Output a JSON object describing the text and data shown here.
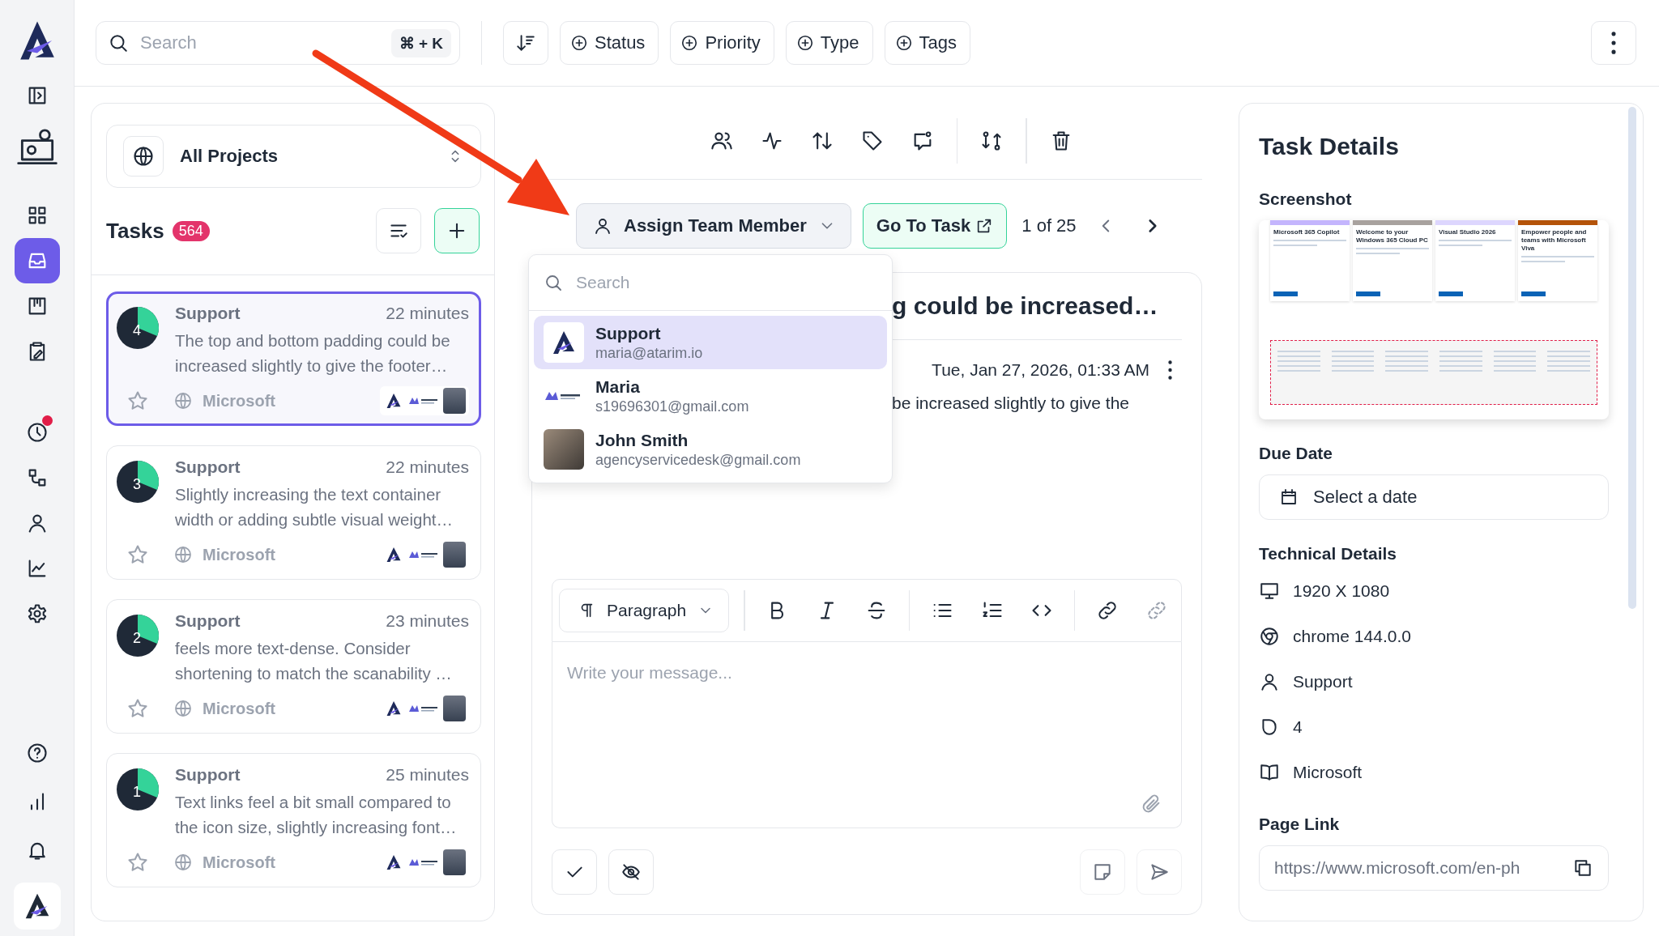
{
  "sidebar": {
    "items": [
      {
        "selected": false
      },
      {
        "selected": false
      },
      {
        "selected": false
      },
      {
        "selected": true
      },
      {
        "selected": false
      },
      {
        "selected": false
      },
      {
        "selected": false,
        "alert": true
      },
      {
        "selected": false
      },
      {
        "selected": false
      },
      {
        "selected": false
      },
      {
        "selected": false
      }
    ],
    "bottom_items": [
      {
        "selected": false
      },
      {
        "selected": false
      },
      {
        "selected": false
      }
    ]
  },
  "top_bar": {
    "search": {
      "placeholder": "Search",
      "shortcut": "⌘ + K"
    },
    "filters": [
      "Status",
      "Priority",
      "Type",
      "Tags"
    ]
  },
  "task_list": {
    "project": "All Projects",
    "title": "Tasks",
    "count": "564",
    "tasks": [
      {
        "number": "4",
        "author": "Support",
        "time": "22 minutes",
        "text": "The top and bottom padding could be increased slightly to give the footer…",
        "project": "Microsoft",
        "selected": true
      },
      {
        "number": "3",
        "author": "Support",
        "time": "22 minutes",
        "text": "Slightly increasing the text container width or adding subtle visual weight…",
        "project": "Microsoft",
        "selected": false
      },
      {
        "number": "2",
        "author": "Support",
        "time": "23 minutes",
        "text": "feels more text-dense. Consider shortening to match the scanability …",
        "project": "Microsoft",
        "selected": false
      },
      {
        "number": "1",
        "author": "Support",
        "time": "25 minutes",
        "text": "Text links feel a bit small compared to the icon size, slightly increasing font…",
        "project": "Microsoft",
        "selected": false
      }
    ]
  },
  "task_view": {
    "assign": {
      "label": "Assign Team Member",
      "expanded": true
    },
    "go_to": "Go To Task",
    "pager": "1 of 25",
    "title": "g could be increased…",
    "date": "Tue, Jan 27, 2026, 01:33 AM",
    "body": "be increased slightly to give the",
    "member_menu": {
      "placeholder": "Search",
      "members": [
        {
          "kind": "logo",
          "name": "Support",
          "email": "maria@atarim.io",
          "selected": true
        },
        {
          "kind": "brand",
          "name": "Maria",
          "email": "s19696301@gmail.com",
          "selected": false
        },
        {
          "kind": "photo",
          "name": "John Smith",
          "email": "agencyservicedesk@gmail.com",
          "selected": false
        }
      ]
    },
    "editor": {
      "block_style": "Paragraph",
      "placeholder": "Write your message..."
    }
  },
  "details": {
    "title": "Task Details",
    "screenshot_label": "Screenshot",
    "screenshot": {
      "cards": [
        "Microsoft 365 Copilot",
        "Welcome to your Windows 365 Cloud PC",
        "Visual Studio 2026",
        "Empower people and teams with Microsoft Viva"
      ]
    },
    "due_date_label": "Due Date",
    "due_date_placeholder": "Select a date",
    "technical_label": "Technical Details",
    "technical": [
      {
        "kind": "screen",
        "text": "1920 X 1080"
      },
      {
        "kind": "browser",
        "text": "chrome 144.0.0"
      },
      {
        "kind": "user",
        "text": "Support"
      },
      {
        "kind": "number",
        "text": "4"
      },
      {
        "kind": "project",
        "text": "Microsoft"
      }
    ],
    "page_link_label": "Page Link",
    "page_link": "https://www.microsoft.com/en-ph"
  }
}
